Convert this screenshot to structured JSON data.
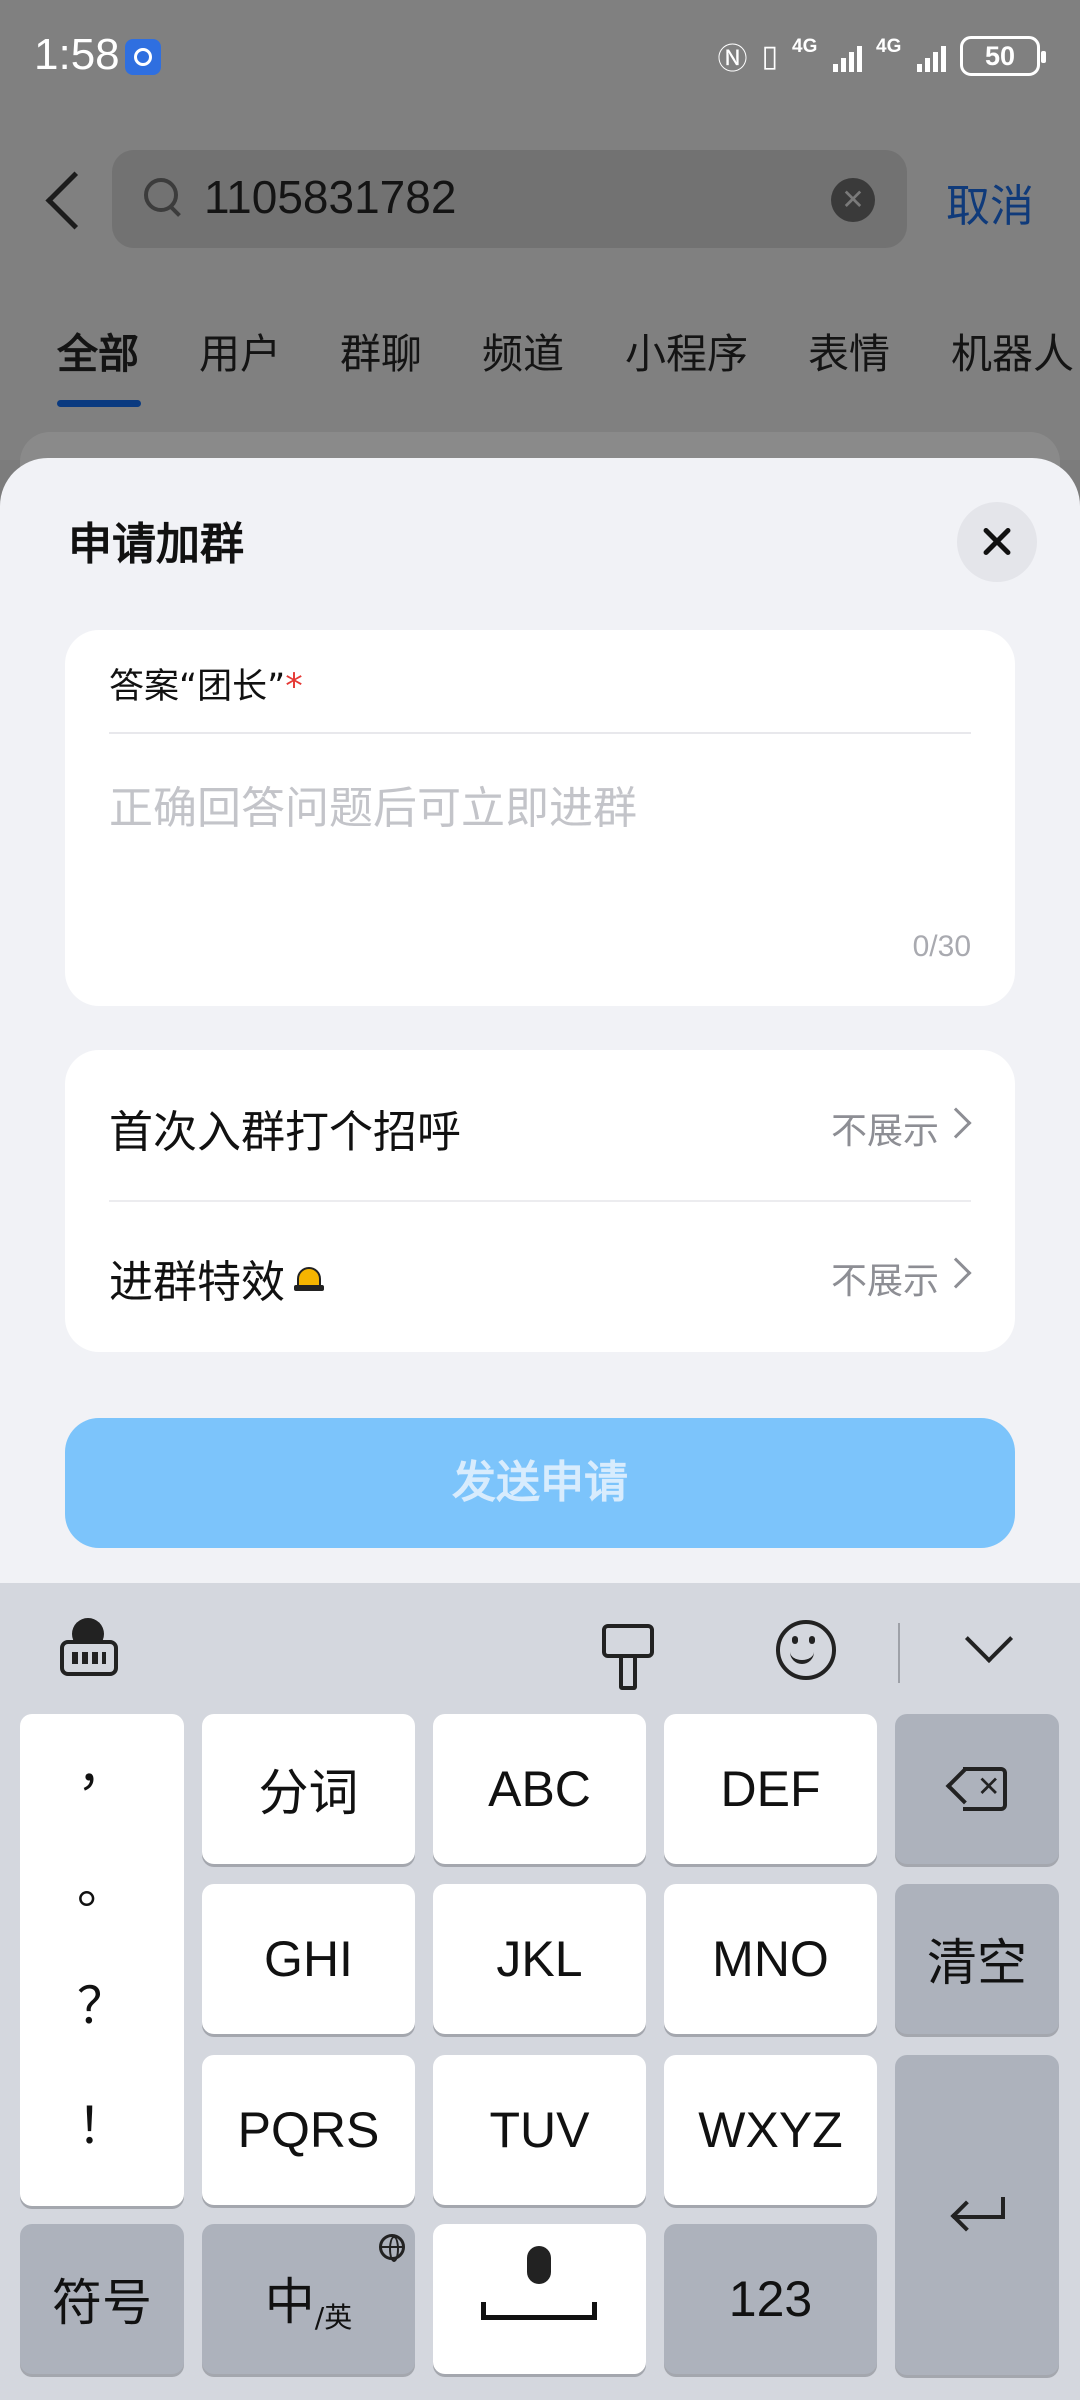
{
  "status_bar": {
    "time": "1:58",
    "network_1": "4G",
    "network_2": "4G",
    "battery": "50"
  },
  "search": {
    "query": "1105831782",
    "cancel_label": "取消"
  },
  "tabs": [
    {
      "label": "全部",
      "active": true
    },
    {
      "label": "用户"
    },
    {
      "label": "群聊"
    },
    {
      "label": "频道"
    },
    {
      "label": "小程序"
    },
    {
      "label": "表情"
    },
    {
      "label": "机器人"
    }
  ],
  "sheet": {
    "title": "申请加群",
    "answer": {
      "label": "答案“团长”",
      "required_mark": "*",
      "placeholder": "正确回答问题后可立即进群",
      "counter": "0/30"
    },
    "options": [
      {
        "label": "首次入群打个招呼",
        "value": "不展示"
      },
      {
        "label": "进群特效",
        "value": "不展示",
        "icon": "hat-emoji-icon"
      }
    ],
    "send_label": "发送申请"
  },
  "keyboard": {
    "punctuation": [
      "，",
      "。",
      "？",
      "！"
    ],
    "row1": [
      "分词",
      "ABC",
      "DEF"
    ],
    "row2": [
      "GHI",
      "JKL",
      "MNO"
    ],
    "clear_label": "清空",
    "row3": [
      "PQRS",
      "TUV",
      "WXYZ"
    ],
    "symbols_label": "符号",
    "lang_main": "中",
    "lang_sub": "/英",
    "numbers_label": "123"
  },
  "colors": {
    "send_button": "#7cc4fb",
    "accent": "#0a3a80",
    "required": "#e53935"
  }
}
